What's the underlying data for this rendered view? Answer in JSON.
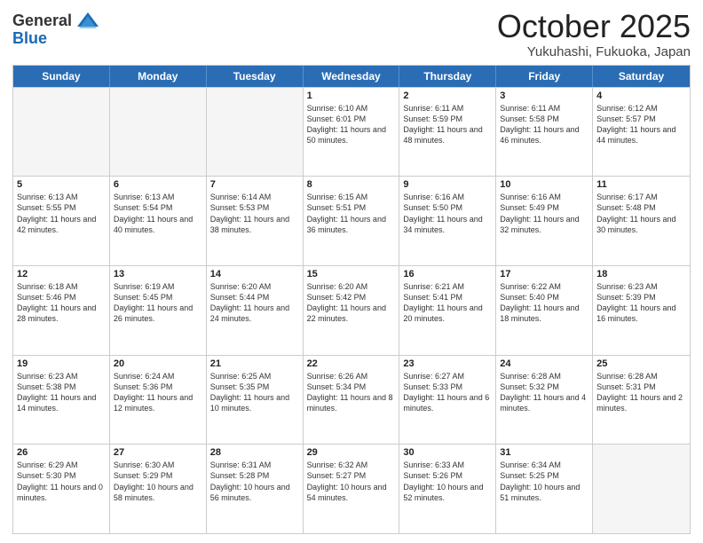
{
  "header": {
    "logo_general": "General",
    "logo_blue": "Blue",
    "month": "October 2025",
    "location": "Yukuhashi, Fukuoka, Japan"
  },
  "weekdays": [
    "Sunday",
    "Monday",
    "Tuesday",
    "Wednesday",
    "Thursday",
    "Friday",
    "Saturday"
  ],
  "weeks": [
    [
      {
        "day": "",
        "sunrise": "",
        "sunset": "",
        "daylight": ""
      },
      {
        "day": "",
        "sunrise": "",
        "sunset": "",
        "daylight": ""
      },
      {
        "day": "",
        "sunrise": "",
        "sunset": "",
        "daylight": ""
      },
      {
        "day": "1",
        "sunrise": "Sunrise: 6:10 AM",
        "sunset": "Sunset: 6:01 PM",
        "daylight": "Daylight: 11 hours and 50 minutes."
      },
      {
        "day": "2",
        "sunrise": "Sunrise: 6:11 AM",
        "sunset": "Sunset: 5:59 PM",
        "daylight": "Daylight: 11 hours and 48 minutes."
      },
      {
        "day": "3",
        "sunrise": "Sunrise: 6:11 AM",
        "sunset": "Sunset: 5:58 PM",
        "daylight": "Daylight: 11 hours and 46 minutes."
      },
      {
        "day": "4",
        "sunrise": "Sunrise: 6:12 AM",
        "sunset": "Sunset: 5:57 PM",
        "daylight": "Daylight: 11 hours and 44 minutes."
      }
    ],
    [
      {
        "day": "5",
        "sunrise": "Sunrise: 6:13 AM",
        "sunset": "Sunset: 5:55 PM",
        "daylight": "Daylight: 11 hours and 42 minutes."
      },
      {
        "day": "6",
        "sunrise": "Sunrise: 6:13 AM",
        "sunset": "Sunset: 5:54 PM",
        "daylight": "Daylight: 11 hours and 40 minutes."
      },
      {
        "day": "7",
        "sunrise": "Sunrise: 6:14 AM",
        "sunset": "Sunset: 5:53 PM",
        "daylight": "Daylight: 11 hours and 38 minutes."
      },
      {
        "day": "8",
        "sunrise": "Sunrise: 6:15 AM",
        "sunset": "Sunset: 5:51 PM",
        "daylight": "Daylight: 11 hours and 36 minutes."
      },
      {
        "day": "9",
        "sunrise": "Sunrise: 6:16 AM",
        "sunset": "Sunset: 5:50 PM",
        "daylight": "Daylight: 11 hours and 34 minutes."
      },
      {
        "day": "10",
        "sunrise": "Sunrise: 6:16 AM",
        "sunset": "Sunset: 5:49 PM",
        "daylight": "Daylight: 11 hours and 32 minutes."
      },
      {
        "day": "11",
        "sunrise": "Sunrise: 6:17 AM",
        "sunset": "Sunset: 5:48 PM",
        "daylight": "Daylight: 11 hours and 30 minutes."
      }
    ],
    [
      {
        "day": "12",
        "sunrise": "Sunrise: 6:18 AM",
        "sunset": "Sunset: 5:46 PM",
        "daylight": "Daylight: 11 hours and 28 minutes."
      },
      {
        "day": "13",
        "sunrise": "Sunrise: 6:19 AM",
        "sunset": "Sunset: 5:45 PM",
        "daylight": "Daylight: 11 hours and 26 minutes."
      },
      {
        "day": "14",
        "sunrise": "Sunrise: 6:20 AM",
        "sunset": "Sunset: 5:44 PM",
        "daylight": "Daylight: 11 hours and 24 minutes."
      },
      {
        "day": "15",
        "sunrise": "Sunrise: 6:20 AM",
        "sunset": "Sunset: 5:42 PM",
        "daylight": "Daylight: 11 hours and 22 minutes."
      },
      {
        "day": "16",
        "sunrise": "Sunrise: 6:21 AM",
        "sunset": "Sunset: 5:41 PM",
        "daylight": "Daylight: 11 hours and 20 minutes."
      },
      {
        "day": "17",
        "sunrise": "Sunrise: 6:22 AM",
        "sunset": "Sunset: 5:40 PM",
        "daylight": "Daylight: 11 hours and 18 minutes."
      },
      {
        "day": "18",
        "sunrise": "Sunrise: 6:23 AM",
        "sunset": "Sunset: 5:39 PM",
        "daylight": "Daylight: 11 hours and 16 minutes."
      }
    ],
    [
      {
        "day": "19",
        "sunrise": "Sunrise: 6:23 AM",
        "sunset": "Sunset: 5:38 PM",
        "daylight": "Daylight: 11 hours and 14 minutes."
      },
      {
        "day": "20",
        "sunrise": "Sunrise: 6:24 AM",
        "sunset": "Sunset: 5:36 PM",
        "daylight": "Daylight: 11 hours and 12 minutes."
      },
      {
        "day": "21",
        "sunrise": "Sunrise: 6:25 AM",
        "sunset": "Sunset: 5:35 PM",
        "daylight": "Daylight: 11 hours and 10 minutes."
      },
      {
        "day": "22",
        "sunrise": "Sunrise: 6:26 AM",
        "sunset": "Sunset: 5:34 PM",
        "daylight": "Daylight: 11 hours and 8 minutes."
      },
      {
        "day": "23",
        "sunrise": "Sunrise: 6:27 AM",
        "sunset": "Sunset: 5:33 PM",
        "daylight": "Daylight: 11 hours and 6 minutes."
      },
      {
        "day": "24",
        "sunrise": "Sunrise: 6:28 AM",
        "sunset": "Sunset: 5:32 PM",
        "daylight": "Daylight: 11 hours and 4 minutes."
      },
      {
        "day": "25",
        "sunrise": "Sunrise: 6:28 AM",
        "sunset": "Sunset: 5:31 PM",
        "daylight": "Daylight: 11 hours and 2 minutes."
      }
    ],
    [
      {
        "day": "26",
        "sunrise": "Sunrise: 6:29 AM",
        "sunset": "Sunset: 5:30 PM",
        "daylight": "Daylight: 11 hours and 0 minutes."
      },
      {
        "day": "27",
        "sunrise": "Sunrise: 6:30 AM",
        "sunset": "Sunset: 5:29 PM",
        "daylight": "Daylight: 10 hours and 58 minutes."
      },
      {
        "day": "28",
        "sunrise": "Sunrise: 6:31 AM",
        "sunset": "Sunset: 5:28 PM",
        "daylight": "Daylight: 10 hours and 56 minutes."
      },
      {
        "day": "29",
        "sunrise": "Sunrise: 6:32 AM",
        "sunset": "Sunset: 5:27 PM",
        "daylight": "Daylight: 10 hours and 54 minutes."
      },
      {
        "day": "30",
        "sunrise": "Sunrise: 6:33 AM",
        "sunset": "Sunset: 5:26 PM",
        "daylight": "Daylight: 10 hours and 52 minutes."
      },
      {
        "day": "31",
        "sunrise": "Sunrise: 6:34 AM",
        "sunset": "Sunset: 5:25 PM",
        "daylight": "Daylight: 10 hours and 51 minutes."
      },
      {
        "day": "",
        "sunrise": "",
        "sunset": "",
        "daylight": ""
      }
    ]
  ]
}
